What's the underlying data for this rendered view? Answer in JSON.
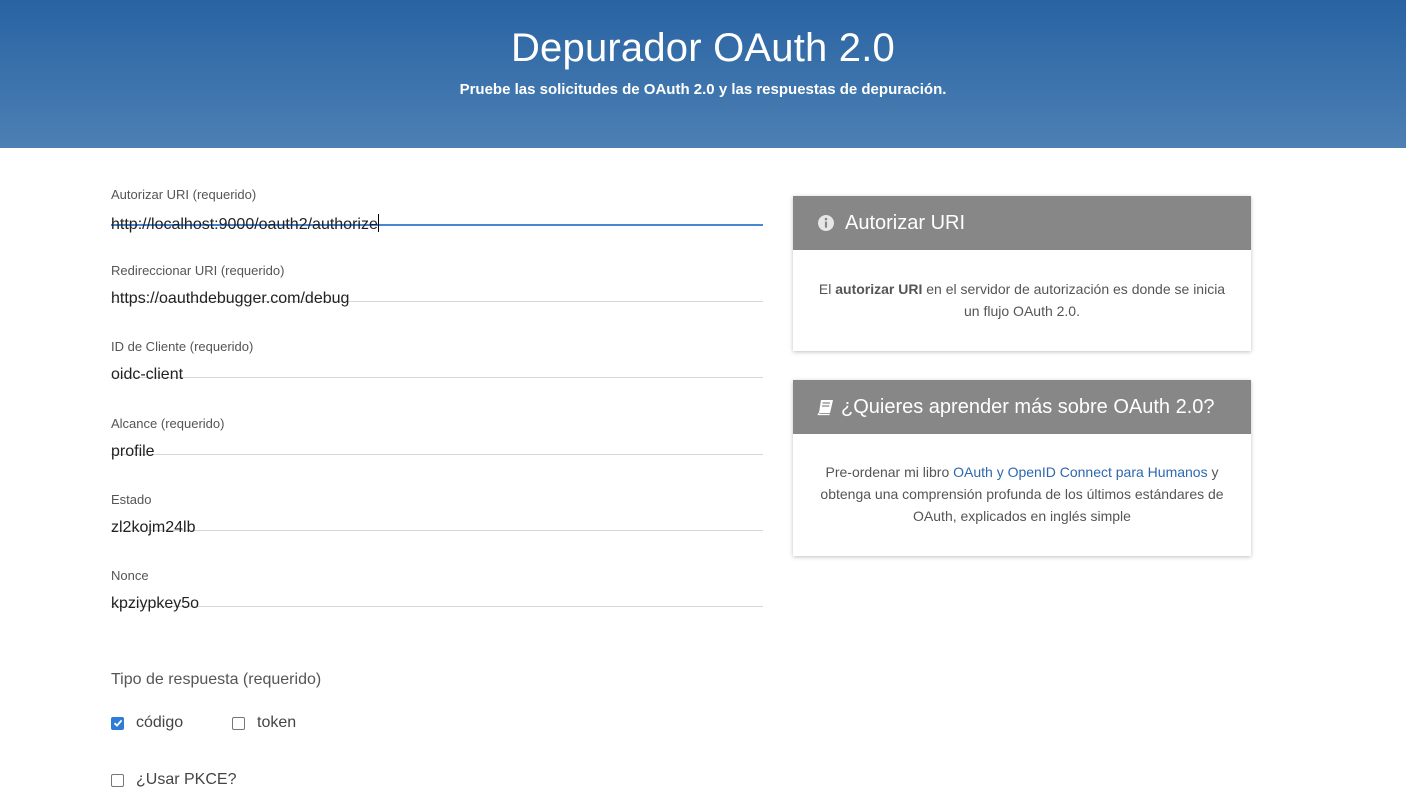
{
  "header": {
    "title": "Depurador OAuth 2.0",
    "subtitle": "Pruebe las solicitudes de OAuth 2.0 y las respuestas de depuración."
  },
  "form": {
    "fields": [
      {
        "label": "Autorizar URI (requerido)",
        "value": "http://localhost:9000/oauth2/authorize"
      },
      {
        "label": "Redireccionar URI (requerido)",
        "value": "https://oauthdebugger.com/debug"
      },
      {
        "label": "ID de Cliente (requerido)",
        "value": "oidc-client"
      },
      {
        "label": "Alcance (requerido)",
        "value": "profile"
      },
      {
        "label": "Estado",
        "value": "zl2kojm24lb"
      },
      {
        "label": "Nonce",
        "value": "kpziypkey5o"
      }
    ],
    "response_type": {
      "label": "Tipo de respuesta (requerido)",
      "options": [
        {
          "label": "código",
          "checked": true
        },
        {
          "label": "token",
          "checked": false
        }
      ]
    },
    "pkce": {
      "label": "¿Usar PKCE?",
      "checked": false
    }
  },
  "cards": {
    "authorize": {
      "icon": "info-circle-icon",
      "title": "Autorizar URI",
      "text_before": "El ",
      "text_bold": "autorizar URI",
      "text_after": " en el servidor de autorización es donde se inicia un flujo OAuth 2.0."
    },
    "learn": {
      "icon": "book-icon",
      "title": "¿Quieres aprender más sobre OAuth 2.0?",
      "text_before": "Pre-ordenar mi libro ",
      "link": "OAuth y OpenID Connect para Humanos",
      "text_after": " y obtenga una comprensión profunda de los últimos estándares de OAuth, explicados en inglés simple"
    }
  },
  "colors": {
    "header_top": "#2863a2",
    "header_bottom": "#4d80b4",
    "card_header": "#878787",
    "focus_underline": "#4a84d4",
    "checkbox_checked": "#2f7bd8",
    "link": "#2d67b0"
  }
}
